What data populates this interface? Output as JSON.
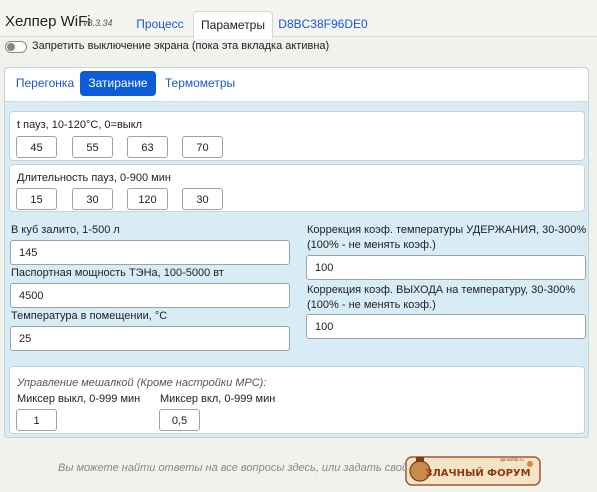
{
  "app": {
    "title": "Хелпер WiFi",
    "version": "v8.3.34"
  },
  "top_tabs": [
    {
      "label": "Процесс"
    },
    {
      "label": "Параметры"
    },
    {
      "label": "D8BC38F96DE0"
    }
  ],
  "screen_toggle": {
    "label": "Запретить выключение экрана (пока эта вкладка активна)"
  },
  "sub_tabs": [
    {
      "label": "Перегонка"
    },
    {
      "label": "Затирание"
    },
    {
      "label": "Термометры"
    }
  ],
  "pause_temps": {
    "label": "t пауз, 10-120°C, 0=выкл",
    "values": [
      "45",
      "55",
      "63",
      "70"
    ]
  },
  "pause_durations": {
    "label": "Длительность пауз, 0-900 мин",
    "values": [
      "15",
      "30",
      "120",
      "30"
    ]
  },
  "left_fields": [
    {
      "label": "В куб залито, 1-500 л",
      "value": "145"
    },
    {
      "label": "Паспортная мощность ТЭНа, 100-5000 вт",
      "value": "4500"
    },
    {
      "label": "Температура в помещении, °C",
      "value": "25"
    }
  ],
  "right_fields": [
    {
      "label_line1": "Коррекция коэф. температуры УДЕРЖАНИЯ, 30-300%",
      "label_line2": "(100% - не менять коэф.)",
      "value": "100"
    },
    {
      "label_line1": "Коррекция коэф. ВЫХОДА на температуру, 30-300%",
      "label_line2": "(100% - не менять коэф.)",
      "value": "100"
    }
  ],
  "mixer": {
    "title": "Управление мешалкой (Кроме настройки МРС):",
    "off_label": "Миксер выкл, 0-999 мин",
    "off_value": "1",
    "on_label": "Миксер вкл, 0-999 мин",
    "on_value": "0,5"
  },
  "footer": {
    "text": "Вы можете найти ответы на все вопросы здесь, или задать свой:",
    "logo_text": "ЗЛАЧНЫЙ ФОРУМ",
    "logo_small": "goneshik.ru"
  },
  "colors": {
    "accent": "#0b5cd6",
    "link": "#1a56db",
    "panel_bg": "#d8ecf6",
    "logo_brown": "#a05a2c"
  }
}
